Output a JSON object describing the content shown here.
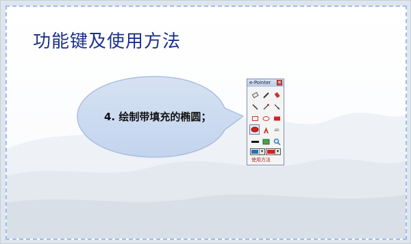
{
  "slide": {
    "title": "功能键及使用方法",
    "bubble_text": "4. 绘制带填充的椭圆；"
  },
  "toolbar": {
    "title": "e-Pointer",
    "close_glyph": "✕",
    "footer_label": "使用方法",
    "text_tool": "ab",
    "colors": {
      "fill_red": "#d42020",
      "border": "#7b8db2"
    }
  }
}
